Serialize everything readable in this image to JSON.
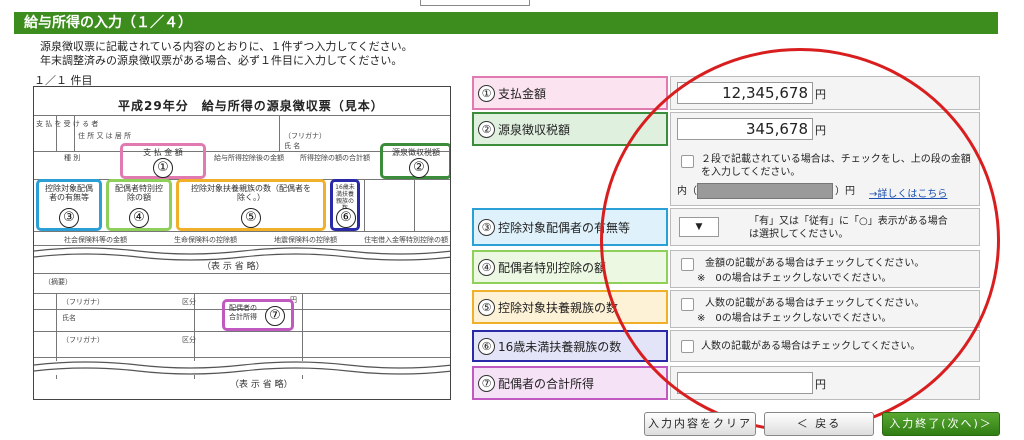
{
  "header": {
    "title": "給与所得の入力（１／４）"
  },
  "intro": {
    "line1": "源泉徴収票に記載されている内容のとおりに、１件ずつ入力してください。",
    "line2": "年末調整済みの源泉徴収票がある場合、必ず１件目に入力してください。"
  },
  "record_count": "１／１ 件目",
  "slip": {
    "title": "平成29年分　給与所得の源泉徴収票（見本）",
    "boxes": [
      {
        "label": "支 払 金 額",
        "num": "①",
        "color": "#e05a9a"
      },
      {
        "label": "源泉徴収税額",
        "num": "②",
        "color": "#3b8c3b"
      },
      {
        "label": "控除対象配偶者の有無等",
        "num": "③",
        "color": "#2aa0d6"
      },
      {
        "label": "配偶者特別控除の額",
        "num": "④",
        "color": "#8fd05a"
      },
      {
        "label": "控除対象扶養親族の数（配偶者を除く。）",
        "num": "⑤",
        "color": "#f0b02a"
      },
      {
        "label": "16歳未満扶養親族の数",
        "num": "⑥",
        "color": "#2a2aa8"
      },
      {
        "label": "配偶者の合計所得",
        "num": "⑦",
        "color": "#c05ac0"
      }
    ],
    "omit1": "（表 示 省 略）",
    "omit2": "（表 示 省 略）",
    "small": {
      "pay": "支 払 を 受 け る 者",
      "addr": "住 所 又 は 居 所",
      "name": "氏 名",
      "kind": "種 別",
      "kyuyo": "給与所得控除後の金額",
      "shotoku": "所得控除の額の合計額",
      "shakai": "社会保険料等の金額",
      "seimei": "生命保険料の控除額",
      "jishin": "地震保険料の控除額",
      "jutaku": "住宅借入金等特別控除の額",
      "tekiyo": "（摘要）",
      "furigana": "（フリガナ）",
      "shimei": "氏名",
      "kubun": "区分",
      "yen": "円"
    }
  },
  "form": {
    "rows": [
      {
        "num": "①",
        "label": "支払金額",
        "border": "#e07ab0",
        "bg": "#fbe4ef"
      },
      {
        "num": "②",
        "label": "源泉徴収税額",
        "border": "#3b8c3b",
        "bg": "#dff0df"
      },
      {
        "num": "③",
        "label": "控除対象配偶者の有無等",
        "border": "#2aa0d6",
        "bg": "#dff2fb"
      },
      {
        "num": "④",
        "label": "配偶者特別控除の額",
        "border": "#8fd05a",
        "bg": "#ecf8e2"
      },
      {
        "num": "⑤",
        "label": "控除対象扶養親族の数",
        "border": "#f0b02a",
        "bg": "#fdf1d6"
      },
      {
        "num": "⑥",
        "label": "16歳未満扶養親族の数",
        "border": "#2a2aa8",
        "bg": "#e4e4f8"
      },
      {
        "num": "⑦",
        "label": "配偶者の合計所得",
        "border": "#c05ac0",
        "bg": "#f6e2f6"
      }
    ],
    "payment_amount": "12,345,678",
    "withholding_amount": "345,678",
    "yen": "円",
    "two_tier_note_1": "２段で記載されている場合は、チェックをし、上の段の金額",
    "two_tier_note_2": "を入力してください。",
    "uchi_label": "内（",
    "uchi_suffix": "）円",
    "details_link": "→詳しくはこちら",
    "spouse_note_1": "「有」又は「従有」に「○」表示がある場合",
    "spouse_note_2": "は選択してください。",
    "spouse_select": "▼",
    "special_note_1": "金額の記載がある場合はチェックしてください。",
    "special_note_2": "※　0の場合はチェックしないでください。",
    "dependents_note_1": "人数の記載がある場合はチェックしてください。",
    "dependents_note_2": "※　0の場合はチェックしないでください。",
    "under16_note": "人数の記載がある場合はチェックしてください。",
    "spouse_income": ""
  },
  "buttons": {
    "clear": "入力内容をクリア",
    "back": "＜ 戻る",
    "done": "入力終了(次へ)＞"
  },
  "colors": {
    "header": "#3d8c1e",
    "annotation": "#d81e1e"
  }
}
